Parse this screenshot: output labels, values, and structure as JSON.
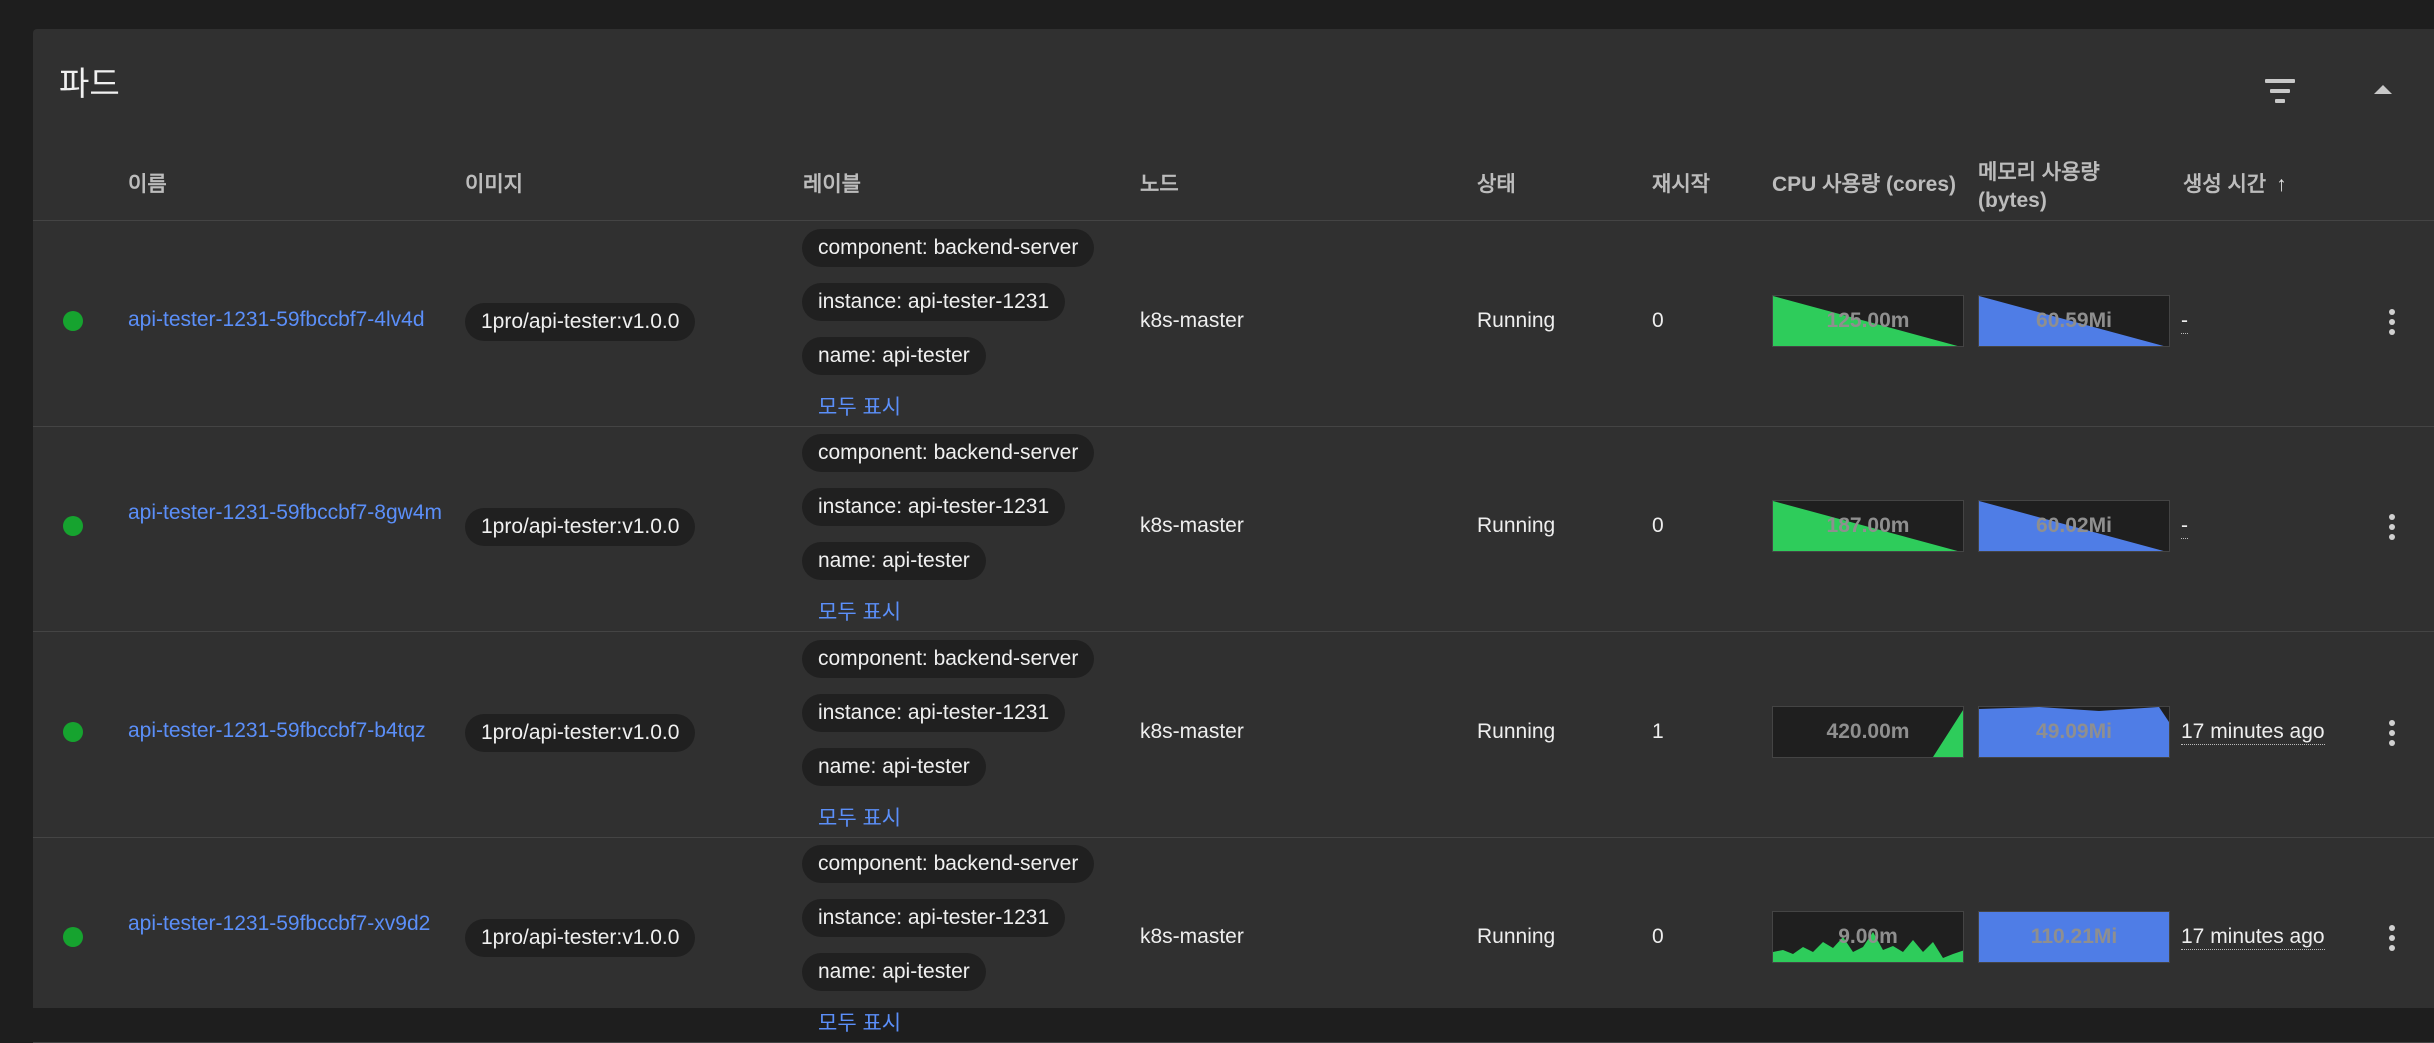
{
  "panel": {
    "title": "파드"
  },
  "columns": {
    "name": "이름",
    "image": "이미지",
    "labels": "레이블",
    "node": "노드",
    "status": "상태",
    "restarts": "재시작",
    "cpu": "CPU 사용량 (cores)",
    "memory_line1": "메모리 사용량",
    "memory_line2": "(bytes)",
    "created": "생성 시간",
    "created_sort_icon": "↑"
  },
  "colors": {
    "running": "#16a32f",
    "cpu": "#2ecc5b",
    "memory": "#4f7de6",
    "link": "#5b8ff9"
  },
  "pods": [
    {
      "name": "api-tester-1231-59fbccbf7-4lv4d",
      "image": "1pro/api-tester:v1.0.0",
      "labels": [
        "component: backend-server",
        "instance: api-tester-1231",
        "name: api-tester"
      ],
      "show_all": "모두 표시",
      "node": "k8s-master",
      "status": "Running",
      "restarts": "0",
      "cpu": "125.00m",
      "memory": "60.59Mi",
      "created": "-"
    },
    {
      "name": "api-tester-1231-59fbccbf7-8gw4m",
      "image": "1pro/api-tester:v1.0.0",
      "labels": [
        "component: backend-server",
        "instance: api-tester-1231",
        "name: api-tester"
      ],
      "show_all": "모두 표시",
      "node": "k8s-master",
      "status": "Running",
      "restarts": "0",
      "cpu": "187.00m",
      "memory": "60.02Mi",
      "created": "-"
    },
    {
      "name": "api-tester-1231-59fbccbf7-b4tqz",
      "image": "1pro/api-tester:v1.0.0",
      "labels": [
        "component: backend-server",
        "instance: api-tester-1231",
        "name: api-tester"
      ],
      "show_all": "모두 표시",
      "node": "k8s-master",
      "status": "Running",
      "restarts": "1",
      "cpu": "420.00m",
      "memory": "49.09Mi",
      "created": "17 minutes ago"
    },
    {
      "name": "api-tester-1231-59fbccbf7-xv9d2",
      "image": "1pro/api-tester:v1.0.0",
      "labels": [
        "component: backend-server",
        "instance: api-tester-1231",
        "name: api-tester"
      ],
      "show_all": "모두 표시",
      "node": "k8s-master",
      "status": "Running",
      "restarts": "0",
      "cpu": "9.00m",
      "memory": "110.21Mi",
      "created": "17 minutes ago"
    }
  ]
}
